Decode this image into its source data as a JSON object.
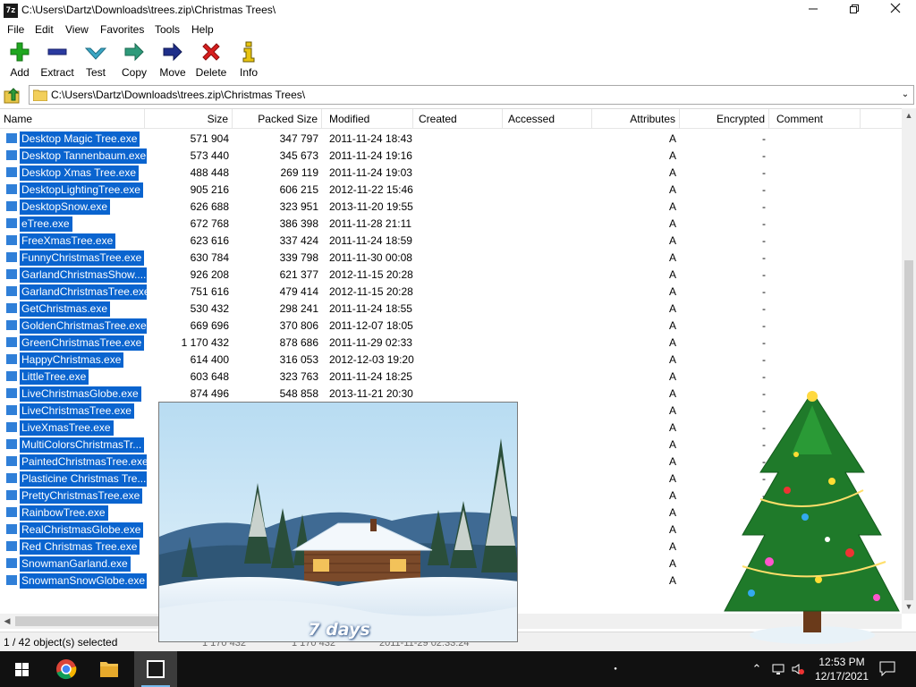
{
  "window": {
    "app_icon": "7z",
    "title": "C:\\Users\\Dartz\\Downloads\\trees.zip\\Christmas Trees\\",
    "min_icon": "minimize-icon",
    "max_icon": "maximize-icon",
    "close_icon": "close-icon"
  },
  "menu": [
    "File",
    "Edit",
    "View",
    "Favorites",
    "Tools",
    "Help"
  ],
  "toolbar": [
    {
      "label": "Add",
      "icon": "plus-icon",
      "color": "#1fa71f"
    },
    {
      "label": "Extract",
      "icon": "minus-icon",
      "color": "#2a3aa0"
    },
    {
      "label": "Test",
      "icon": "check-arrow-icon",
      "color": "#3aa6c4"
    },
    {
      "label": "Copy",
      "icon": "copy-arrow-icon",
      "color": "#2e9a7a"
    },
    {
      "label": "Move",
      "icon": "move-arrow-icon",
      "color": "#1f2f8a"
    },
    {
      "label": "Delete",
      "icon": "delete-x-icon",
      "color": "#d81e1e"
    },
    {
      "label": "Info",
      "icon": "info-icon",
      "color": "#c9a80c"
    }
  ],
  "address": {
    "path": "C:\\Users\\Dartz\\Downloads\\trees.zip\\Christmas Trees\\"
  },
  "columns": [
    "Name",
    "Size",
    "Packed Size",
    "Modified",
    "Created",
    "Accessed",
    "Attributes",
    "Encrypted",
    "Comment"
  ],
  "files": [
    {
      "name": "Desktop Magic Tree.exe",
      "size": "571 904",
      "packed": "347 797",
      "modified": "2011-11-24 18:43",
      "attr": "A",
      "enc": "-"
    },
    {
      "name": "Desktop Tannenbaum.exe",
      "size": "573 440",
      "packed": "345 673",
      "modified": "2011-11-24 19:16",
      "attr": "A",
      "enc": "-"
    },
    {
      "name": "Desktop Xmas Tree.exe",
      "size": "488 448",
      "packed": "269 119",
      "modified": "2011-11-24 19:03",
      "attr": "A",
      "enc": "-"
    },
    {
      "name": "DesktopLightingTree.exe",
      "size": "905 216",
      "packed": "606 215",
      "modified": "2012-11-22 15:46",
      "attr": "A",
      "enc": "-"
    },
    {
      "name": "DesktopSnow.exe",
      "size": "626 688",
      "packed": "323 951",
      "modified": "2013-11-20 19:55",
      "attr": "A",
      "enc": "-"
    },
    {
      "name": "eTree.exe",
      "size": "672 768",
      "packed": "386 398",
      "modified": "2011-11-28 21:11",
      "attr": "A",
      "enc": "-"
    },
    {
      "name": "FreeXmasTree.exe",
      "size": "623 616",
      "packed": "337 424",
      "modified": "2011-11-24 18:59",
      "attr": "A",
      "enc": "-"
    },
    {
      "name": "FunnyChristmasTree.exe",
      "size": "630 784",
      "packed": "339 798",
      "modified": "2011-11-30 00:08",
      "attr": "A",
      "enc": "-"
    },
    {
      "name": "GarlandChristmasShow....",
      "size": "926 208",
      "packed": "621 377",
      "modified": "2012-11-15 20:28",
      "attr": "A",
      "enc": "-"
    },
    {
      "name": "GarlandChristmasTree.exe",
      "size": "751 616",
      "packed": "479 414",
      "modified": "2012-11-15 20:28",
      "attr": "A",
      "enc": "-"
    },
    {
      "name": "GetChristmas.exe",
      "size": "530 432",
      "packed": "298 241",
      "modified": "2011-11-24 18:55",
      "attr": "A",
      "enc": "-"
    },
    {
      "name": "GoldenChristmasTree.exe",
      "size": "669 696",
      "packed": "370 806",
      "modified": "2011-12-07 18:05",
      "attr": "A",
      "enc": "-"
    },
    {
      "name": "GreenChristmasTree.exe",
      "size": "1 170 432",
      "packed": "878 686",
      "modified": "2011-11-29 02:33",
      "attr": "A",
      "enc": "-"
    },
    {
      "name": "HappyChristmas.exe",
      "size": "614 400",
      "packed": "316 053",
      "modified": "2012-12-03 19:20",
      "attr": "A",
      "enc": "-"
    },
    {
      "name": "LittleTree.exe",
      "size": "603 648",
      "packed": "323 763",
      "modified": "2011-11-24 18:25",
      "attr": "A",
      "enc": "-"
    },
    {
      "name": "LiveChristmasGlobe.exe",
      "size": "874 496",
      "packed": "548 858",
      "modified": "2013-11-21 20:30",
      "attr": "A",
      "enc": "-"
    },
    {
      "name": "LiveChristmasTree.exe",
      "size": "",
      "packed": "",
      "modified": "",
      "attr": "A",
      "enc": "-"
    },
    {
      "name": "LiveXmasTree.exe",
      "size": "",
      "packed": "",
      "modified": "",
      "attr": "A",
      "enc": "-"
    },
    {
      "name": "MultiColorsChristmasTr...",
      "size": "",
      "packed": "",
      "modified": "",
      "attr": "A",
      "enc": "-"
    },
    {
      "name": "PaintedChristmasTree.exe",
      "size": "",
      "packed": "",
      "modified": "",
      "attr": "A",
      "enc": "-"
    },
    {
      "name": "Plasticine Christmas Tre...",
      "size": "",
      "packed": "",
      "modified": "",
      "attr": "A",
      "enc": "-"
    },
    {
      "name": "PrettyChristmasTree.exe",
      "size": "",
      "packed": "",
      "modified": "",
      "attr": "A",
      "enc": "-"
    },
    {
      "name": "RainbowTree.exe",
      "size": "",
      "packed": "",
      "modified": "",
      "attr": "A",
      "enc": "-"
    },
    {
      "name": "RealChristmasGlobe.exe",
      "size": "",
      "packed": "",
      "modified": "",
      "attr": "A",
      "enc": "-"
    },
    {
      "name": "Red Christmas Tree.exe",
      "size": "",
      "packed": "",
      "modified": "",
      "attr": "A",
      "enc": "-"
    },
    {
      "name": "SnowmanGarland.exe",
      "size": "",
      "packed": "",
      "modified": "",
      "attr": "A",
      "enc": "-"
    },
    {
      "name": "SnowmanSnowGlobe.exe",
      "size": "",
      "packed": "",
      "modified": "",
      "attr": "A",
      "enc": "-"
    }
  ],
  "status": {
    "selection": "1 / 42 object(s) selected",
    "selected_size": "1 170 432",
    "selected_packed": "1 170 432",
    "selected_modified": "2011-11-29 02:33:24"
  },
  "popup": {
    "caption": "7 days"
  },
  "taskbar": {
    "start_icon": "windows-start-icon",
    "apps": [
      {
        "name": "chrome-icon",
        "active": false
      },
      {
        "name": "file-explorer-icon",
        "active": false
      },
      {
        "name": "7zip-icon",
        "active": true,
        "label": "7z"
      }
    ],
    "time": "12:53 PM",
    "date": "12/17/2021"
  },
  "colors": {
    "selection": "#0a64cf",
    "taskbar": "#111111",
    "accent": "#76b9ed"
  }
}
